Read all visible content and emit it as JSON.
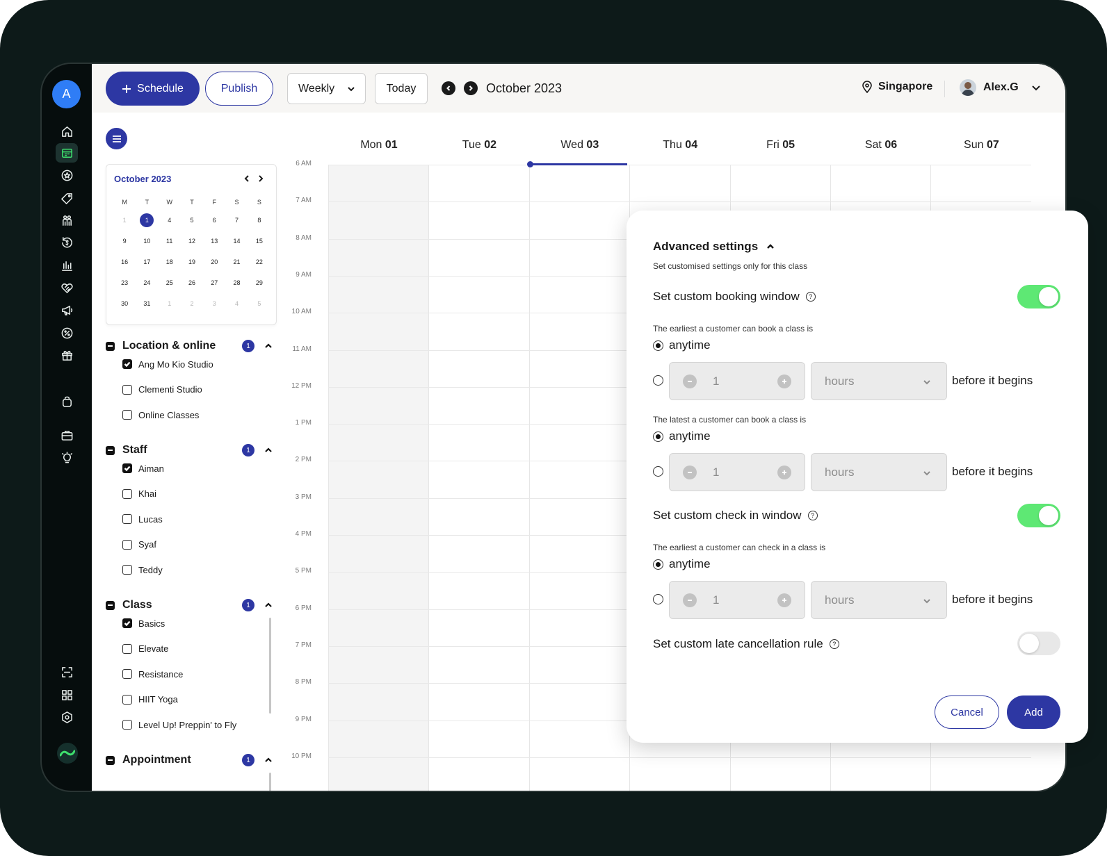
{
  "rail": {
    "avatar_initial": "A",
    "icons": [
      "home-icon",
      "calendar-icon",
      "star-badge-icon",
      "tag-icon",
      "people-icon",
      "refund-icon",
      "bar-chart-icon",
      "handshake-icon",
      "megaphone-icon",
      "discount-icon",
      "gift-icon",
      "bag-icon",
      "briefcase-icon",
      "bulb-icon",
      "scan-icon",
      "apps-grid-icon",
      "settings-icon"
    ],
    "active_icon": "calendar-icon",
    "accent_color": "#3ee06d"
  },
  "toolbar": {
    "schedule_label": "Schedule",
    "publish_label": "Publish",
    "view_label": "Weekly",
    "today_label": "Today",
    "month_label": "October 2023",
    "location": "Singapore",
    "user_name": "Alex.G",
    "primary_color": "#2d37a3"
  },
  "mini_calendar": {
    "title": "October 2023",
    "weekdays": [
      "M",
      "T",
      "W",
      "T",
      "F",
      "S",
      "S"
    ],
    "days": [
      {
        "d": "1",
        "dim": true
      },
      {
        "d": "1",
        "sel": true
      },
      {
        "d": "4"
      },
      {
        "d": "5"
      },
      {
        "d": "6"
      },
      {
        "d": "7"
      },
      {
        "d": "8"
      },
      {
        "d": "9"
      },
      {
        "d": "10"
      },
      {
        "d": "11"
      },
      {
        "d": "12"
      },
      {
        "d": "13"
      },
      {
        "d": "14"
      },
      {
        "d": "15"
      },
      {
        "d": "16"
      },
      {
        "d": "17"
      },
      {
        "d": "18"
      },
      {
        "d": "19"
      },
      {
        "d": "20"
      },
      {
        "d": "21"
      },
      {
        "d": "22"
      },
      {
        "d": "23"
      },
      {
        "d": "24"
      },
      {
        "d": "25"
      },
      {
        "d": "26"
      },
      {
        "d": "27"
      },
      {
        "d": "28"
      },
      {
        "d": "29"
      },
      {
        "d": "30"
      },
      {
        "d": "31"
      },
      {
        "d": "1",
        "dim": true
      },
      {
        "d": "2",
        "dim": true
      },
      {
        "d": "3",
        "dim": true
      },
      {
        "d": "4",
        "dim": true
      },
      {
        "d": "5",
        "dim": true
      }
    ]
  },
  "filters": [
    {
      "title": "Location & online",
      "badge": "1",
      "items": [
        {
          "label": "Ang Mo Kio Studio",
          "checked": true
        },
        {
          "label": "Clementi Studio",
          "checked": false
        },
        {
          "label": "Online Classes",
          "checked": false
        }
      ]
    },
    {
      "title": "Staff",
      "badge": "1",
      "items": [
        {
          "label": "Aiman",
          "checked": true
        },
        {
          "label": "Khai",
          "checked": false
        },
        {
          "label": "Lucas",
          "checked": false
        },
        {
          "label": "Syaf",
          "checked": false
        },
        {
          "label": "Teddy",
          "checked": false
        }
      ]
    },
    {
      "title": "Class",
      "badge": "1",
      "items": [
        {
          "label": "Basics",
          "checked": true
        },
        {
          "label": "Elevate",
          "checked": false
        },
        {
          "label": "Resistance",
          "checked": false
        },
        {
          "label": "HIIT Yoga",
          "checked": false
        },
        {
          "label": "Level Up! Preppin' to Fly",
          "checked": false
        }
      ]
    },
    {
      "title": "Appointment",
      "badge": "1",
      "items": []
    }
  ],
  "calendar": {
    "days": [
      {
        "name": "Mon",
        "num": "01"
      },
      {
        "name": "Tue",
        "num": "02"
      },
      {
        "name": "Wed",
        "num": "03"
      },
      {
        "name": "Thu",
        "num": "04"
      },
      {
        "name": "Fri",
        "num": "05"
      },
      {
        "name": "Sat",
        "num": "06"
      },
      {
        "name": "Sun",
        "num": "07"
      }
    ],
    "today_index": 2,
    "times": [
      "6 AM",
      "7 AM",
      "8 AM",
      "9 AM",
      "10 AM",
      "11 AM",
      "12 PM",
      "1 PM",
      "2 PM",
      "3 PM",
      "4 PM",
      "5 PM",
      "6 PM",
      "7 PM",
      "8 PM",
      "9 PM",
      "10 PM"
    ]
  },
  "modal": {
    "title": "Advanced settings",
    "subtitle": "Set customised settings only for this class",
    "booking_window": {
      "label": "Set custom booking window",
      "enabled": true,
      "earliest": {
        "caption": "The earliest a customer can book a class is",
        "anytime": "anytime",
        "value": "1",
        "unit": "hours",
        "suffix": "before it begins"
      },
      "latest": {
        "caption": "The latest a customer can book a class is",
        "anytime": "anytime",
        "value": "1",
        "unit": "hours",
        "suffix": "before it begins"
      }
    },
    "checkin_window": {
      "label": "Set custom check in window",
      "enabled": true,
      "earliest": {
        "caption": "The earliest a customer can check in a class is",
        "anytime": "anytime",
        "value": "1",
        "unit": "hours",
        "suffix": "before it begins"
      }
    },
    "late_cancel": {
      "label": "Set custom late cancellation rule",
      "enabled": false
    },
    "cancel_label": "Cancel",
    "add_label": "Add",
    "toggle_on_color": "#5ee874"
  }
}
